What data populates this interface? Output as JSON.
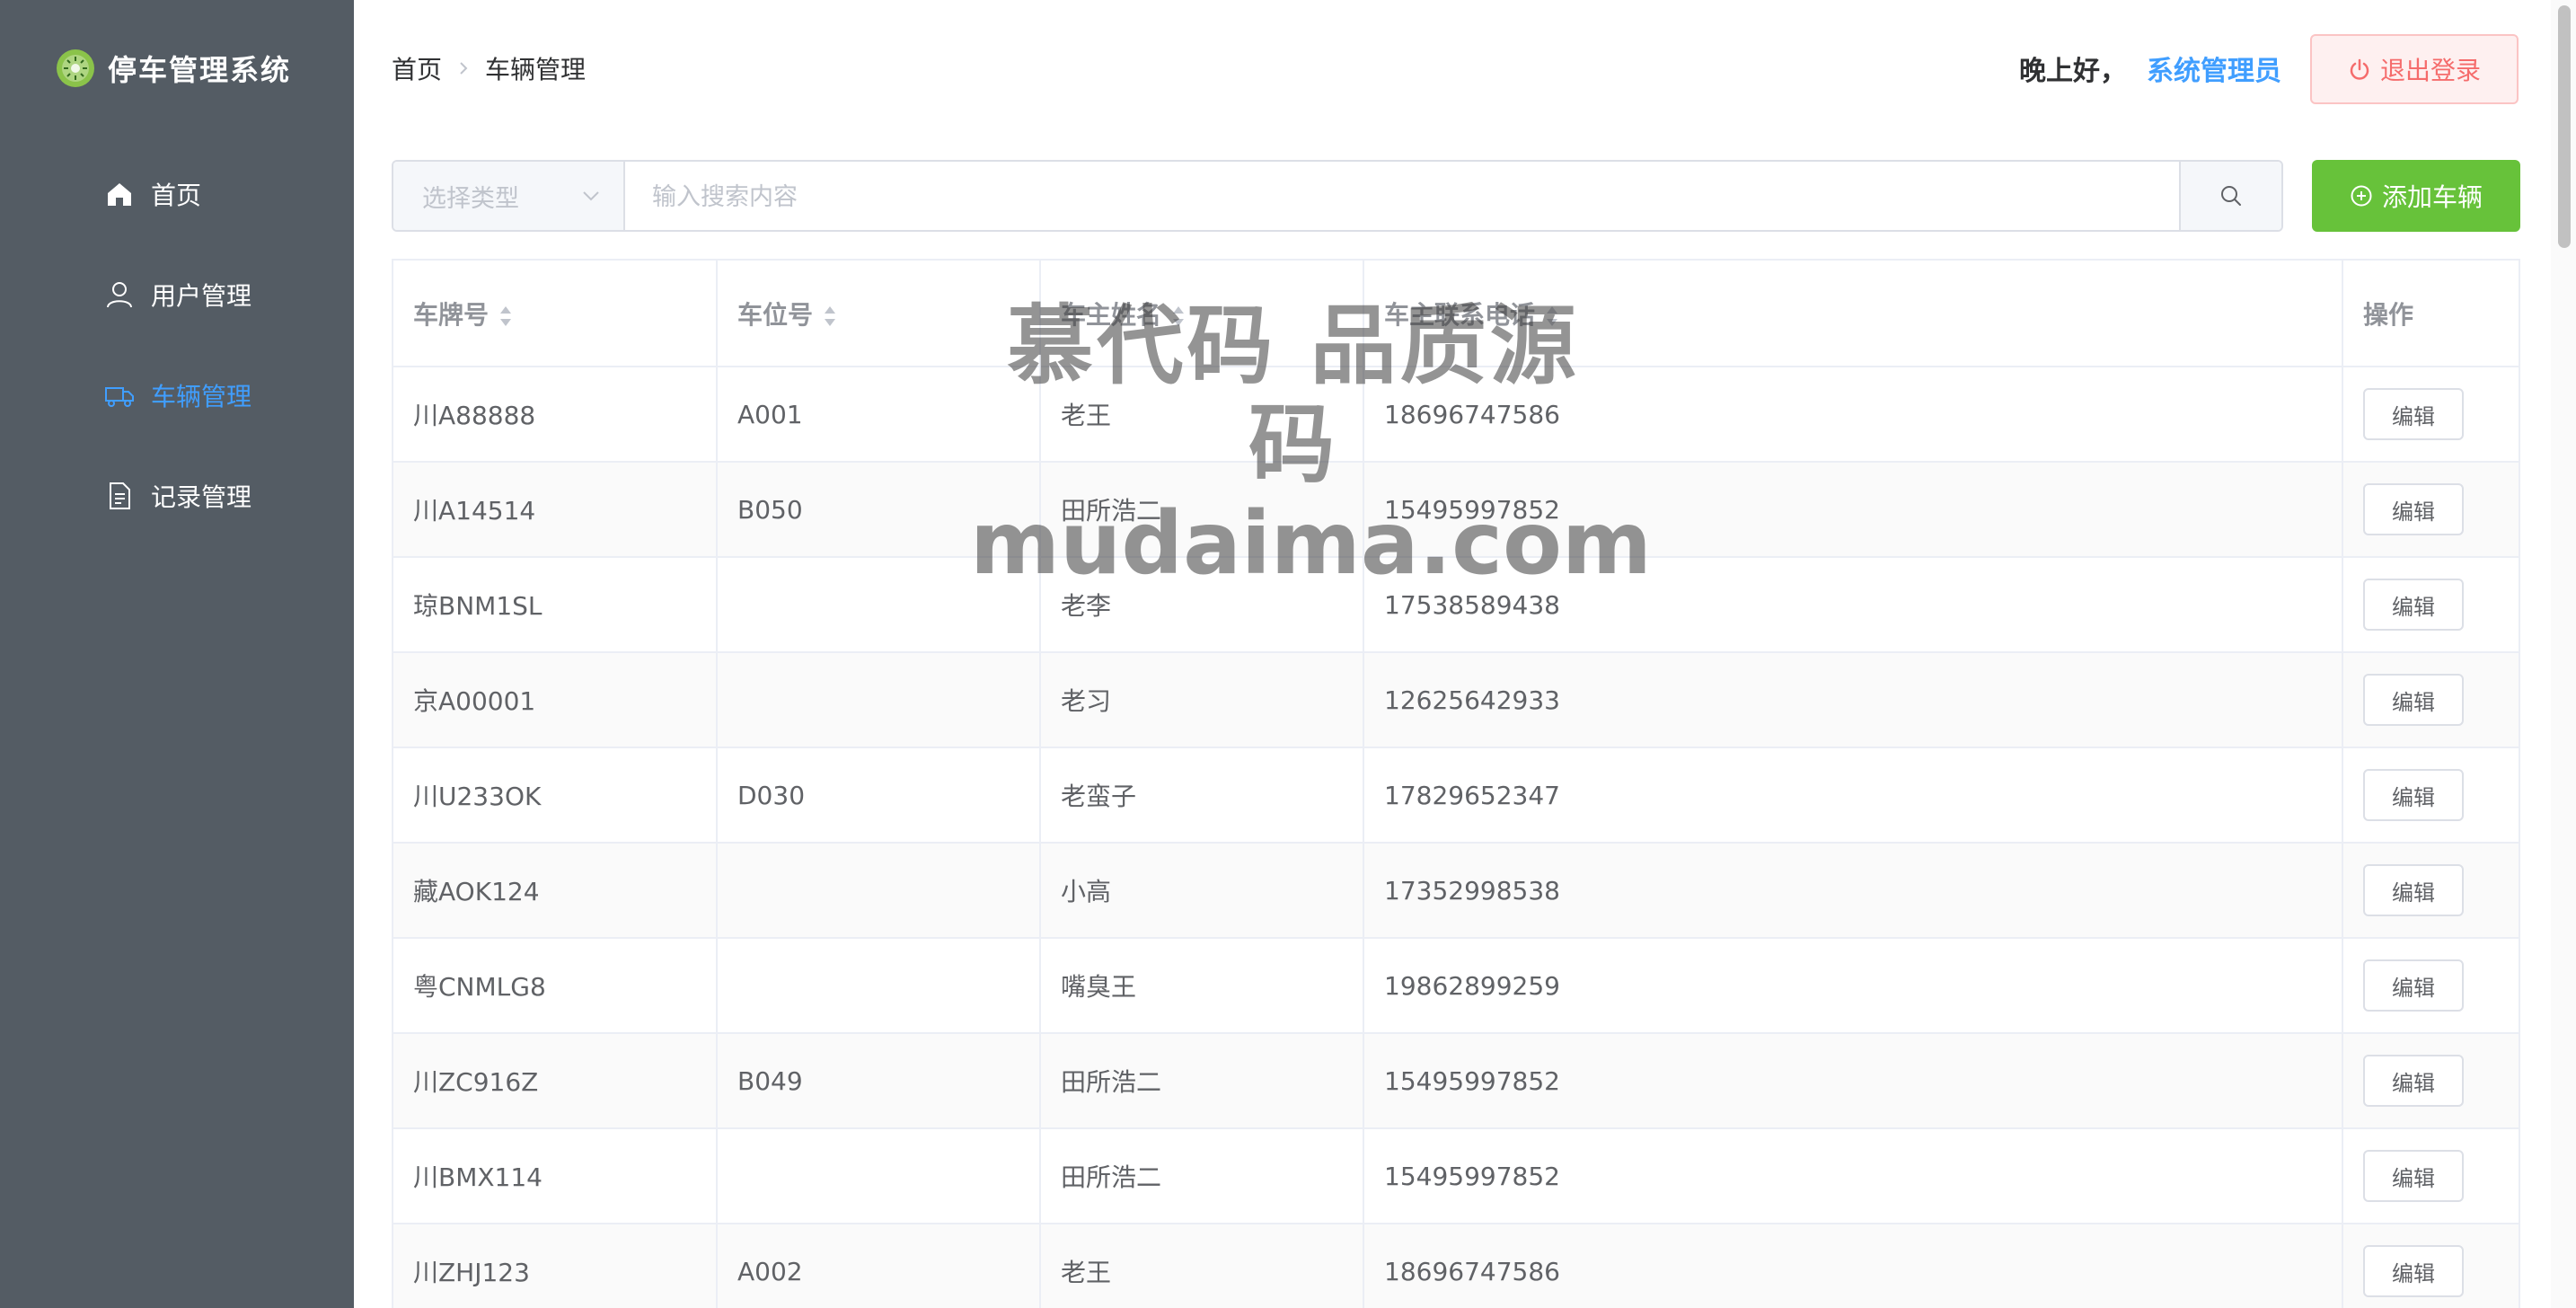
{
  "app": {
    "title": "停车管理系统"
  },
  "sidebar": {
    "items": [
      {
        "label": "首页",
        "icon": "home-icon",
        "active": false
      },
      {
        "label": "用户管理",
        "icon": "user-icon",
        "active": false
      },
      {
        "label": "车辆管理",
        "icon": "truck-icon",
        "active": true
      },
      {
        "label": "记录管理",
        "icon": "document-icon",
        "active": false
      }
    ]
  },
  "header": {
    "breadcrumb": [
      "首页",
      "车辆管理"
    ],
    "greeting": "晚上好，",
    "username": "系统管理员",
    "logout_label": "退出登录"
  },
  "search": {
    "type_placeholder": "选择类型",
    "input_placeholder": "输入搜索内容",
    "add_label": "添加车辆"
  },
  "table": {
    "columns": [
      "车牌号",
      "车位号",
      "车主姓名",
      "车主联系电话",
      "操作"
    ],
    "edit_label": "编辑",
    "rows": [
      {
        "plate": "川A88888",
        "space": "A001",
        "owner": "老王",
        "phone": "18696747586"
      },
      {
        "plate": "川A14514",
        "space": "B050",
        "owner": "田所浩二",
        "phone": "15495997852"
      },
      {
        "plate": "琼BNM1SL",
        "space": "",
        "owner": "老李",
        "phone": "17538589438"
      },
      {
        "plate": "京A00001",
        "space": "",
        "owner": "老习",
        "phone": "12625642933"
      },
      {
        "plate": "川U233OK",
        "space": "D030",
        "owner": "老蛮子",
        "phone": "17829652347"
      },
      {
        "plate": "藏AOK124",
        "space": "",
        "owner": "小高",
        "phone": "17352998538"
      },
      {
        "plate": "粤CNMLG8",
        "space": "",
        "owner": "嘴臭王",
        "phone": "19862899259"
      },
      {
        "plate": "川ZC916Z",
        "space": "B049",
        "owner": "田所浩二",
        "phone": "15495997852"
      },
      {
        "plate": "川BMX114",
        "space": "",
        "owner": "田所浩二",
        "phone": "15495997852"
      },
      {
        "plate": "川ZHJ123",
        "space": "A002",
        "owner": "老王",
        "phone": "18696747586"
      }
    ]
  },
  "watermark": {
    "line1": "慕代码 品质源码",
    "line2": "mudaima.com"
  },
  "colors": {
    "sidebar_bg": "#545c64",
    "active": "#409eff",
    "add_button": "#67c23a",
    "logout": "#f56c6c"
  }
}
